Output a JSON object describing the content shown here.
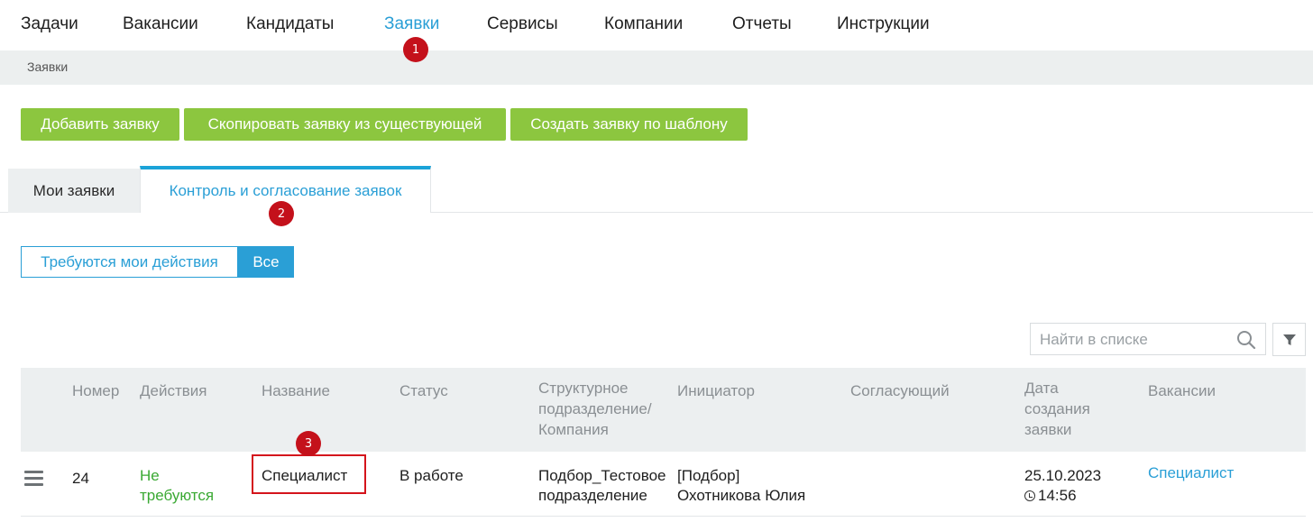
{
  "nav": {
    "items": [
      {
        "label": "Задачи"
      },
      {
        "label": "Вакансии"
      },
      {
        "label": "Кандидаты"
      },
      {
        "label": "Заявки"
      },
      {
        "label": "Сервисы"
      },
      {
        "label": "Компании"
      },
      {
        "label": "Отчеты"
      },
      {
        "label": "Инструкции"
      }
    ],
    "active_index": 3
  },
  "markers": [
    "1",
    "2",
    "3"
  ],
  "breadcrumb": "Заявки",
  "actions": {
    "add": "Добавить заявку",
    "copy": "Скопировать заявку из существующей",
    "template": "Создать заявку по шаблону"
  },
  "tabs": {
    "my": "Мои заявки",
    "control": "Контроль и согласование заявок"
  },
  "filter_toggle": {
    "my_actions": "Требуются мои действия",
    "all": "Все",
    "selected": "all"
  },
  "search": {
    "placeholder": "Найти в списке",
    "icon": "search-icon",
    "filter_icon": "filter-icon"
  },
  "table": {
    "columns": {
      "number": "Номер",
      "actions": "Действия",
      "name": "Название",
      "status": "Статус",
      "department": [
        "Структурное",
        "подразделение/",
        "Компания"
      ],
      "initiator": "Инициатор",
      "approver": "Согласующий",
      "created": [
        "Дата",
        "создания",
        "заявки"
      ],
      "vacancies": "Вакансии"
    },
    "rows": [
      {
        "number": "24",
        "actions": [
          "Не",
          "требуются"
        ],
        "name": "Специалист",
        "status": "В работе",
        "department": [
          "Подбор_Тестовое",
          "подразделение"
        ],
        "initiator": [
          "[Подбор]",
          "Охотникова Юлия"
        ],
        "approver": "",
        "date": "25.10.2023",
        "time": "14:56",
        "vacancy": "Специалист"
      }
    ]
  },
  "colors": {
    "accent": "#2a9fd6",
    "green_button": "#8cc63f",
    "marker": "#c4111b",
    "highlight": "#d4141c"
  }
}
